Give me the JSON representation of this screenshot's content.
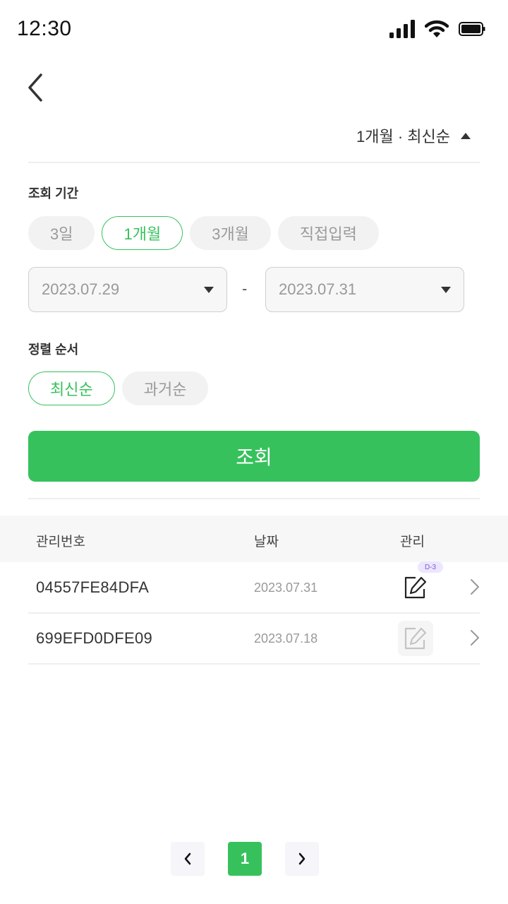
{
  "status_bar": {
    "time": "12:30"
  },
  "filter_summary": {
    "label": "1개월 · 최신순"
  },
  "period": {
    "label": "조회 기간",
    "chips": [
      "3일",
      "1개월",
      "3개월",
      "직접입력"
    ],
    "selected": "1개월",
    "start_date": "2023.07.29",
    "separator": "-",
    "end_date": "2023.07.31"
  },
  "sort": {
    "label": "정렬 순서",
    "chips": [
      "최신순",
      "과거순"
    ],
    "selected": "최신순"
  },
  "search_button": {
    "label": "조회"
  },
  "table": {
    "headers": {
      "id": "관리번호",
      "date": "날짜",
      "manage": "관리"
    },
    "rows": [
      {
        "id": "04557FE84DFA",
        "date": "2023.07.31",
        "badge": "D-3",
        "editable": true
      },
      {
        "id": "699EFD0DFE09",
        "date": "2023.07.18",
        "badge": "",
        "editable": false
      }
    ]
  },
  "pagination": {
    "current_page": "1"
  },
  "colors": {
    "accent": "#37c15d",
    "badge_bg": "#ede6ff",
    "badge_text": "#7d5bd6"
  }
}
